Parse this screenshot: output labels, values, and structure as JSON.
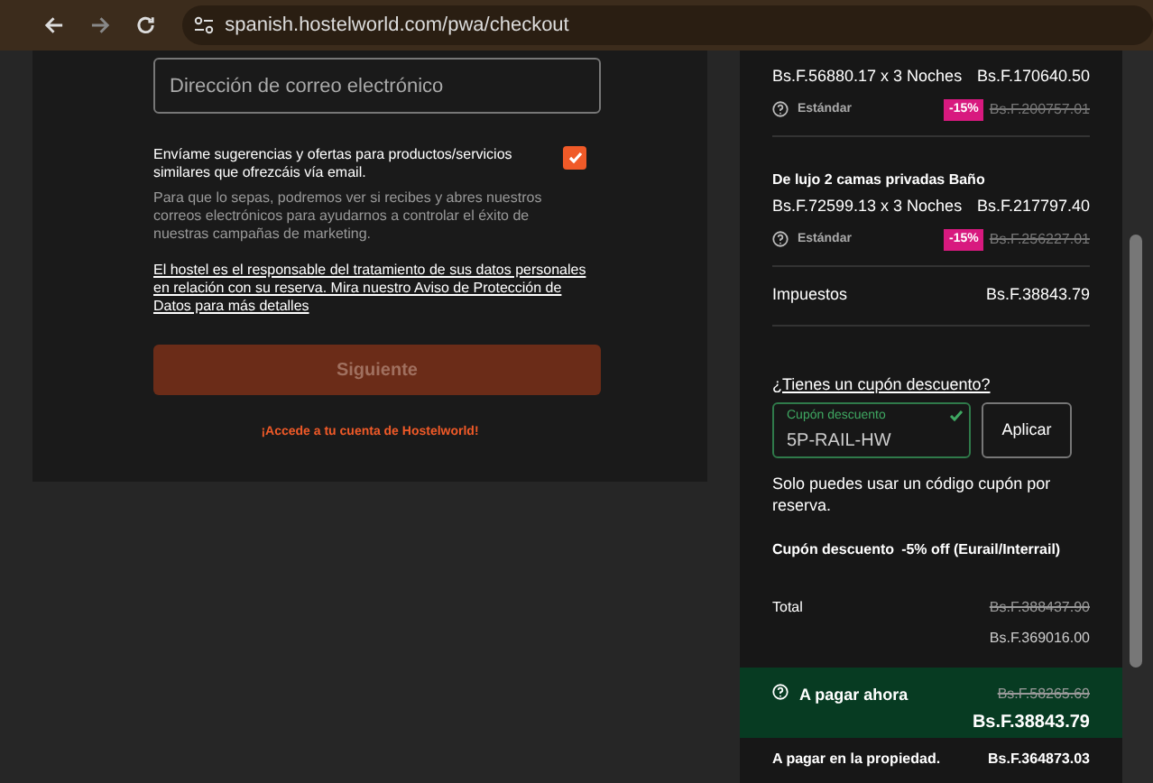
{
  "browser": {
    "url": "spanish.hostelworld.com/pwa/checkout"
  },
  "form": {
    "email_placeholder": "Dirección de correo electrónico",
    "marketing": {
      "label": "Envíame sugerencias y ofertas para productos/servicios similares que ofrezcáis vía email.",
      "checked": true
    },
    "marketing_note": "Para que lo sepas, podremos ver si recibes y abres nuestros correos electrónicos para ayudarnos a controlar el éxito de nuestras campañas de marketing.",
    "privacy_link": "El hostel es el responsable del tratamiento de sus datos personales en relación con su reserva. Mira nuestro Aviso de Protección de Datos para más detalles",
    "next_button": {
      "label": "Siguiente",
      "disabled": true
    },
    "login_link": "¡Accede a tu cuenta de Hostelworld!"
  },
  "summary": {
    "rooms": [
      {
        "price_line": "Bs.F.56880.17 x 3 Noches",
        "total": "Bs.F.170640.50",
        "rate": "Estándar",
        "discount": "-15%",
        "original": "Bs.F.200757.01"
      },
      {
        "title": "De lujo 2 camas privadas Baño",
        "price_line": "Bs.F.72599.13 x 3 Noches",
        "total": "Bs.F.217797.40",
        "rate": "Estándar",
        "discount": "-15%",
        "original": "Bs.F.256227.01"
      }
    ],
    "taxes": {
      "label": "Impuestos",
      "value": "Bs.F.38843.79"
    },
    "coupon": {
      "link": "¿Tienes un cupón descuento?",
      "field_label": "Cupón descuento",
      "value": "5P-RAIL-HW",
      "valid": true,
      "apply": "Aplicar",
      "note": "Solo puedes usar un código cupón por reserva.",
      "applied_label": "Cupón descuento",
      "applied_value": "-5% off (Eurail/Interrail)"
    },
    "total": {
      "label": "Total",
      "original": "Bs.F.388437.90",
      "value": "Bs.F.369016.00"
    },
    "pay_now": {
      "label": "A pagar ahora",
      "original": "Bs.F.58265.69",
      "value": "Bs.F.38843.79"
    },
    "pay_at_property": {
      "label": "A pagar en la propiedad.",
      "value": "Bs.F.364873.03"
    }
  }
}
